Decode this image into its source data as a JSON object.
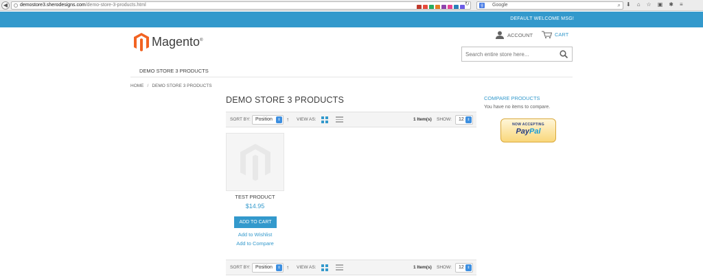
{
  "browser": {
    "url_domain": "demostore3.sherodesigns.com",
    "url_path": "/demo-store-3-products.html",
    "search_engine": "Google",
    "search_engine_icon": "g-icon"
  },
  "header": {
    "welcome_msg": "DEFAULT WELCOME MSG!",
    "logo_text": "Magento",
    "logo_mark": "®",
    "account_label": "ACCOUNT",
    "cart_label": "CART",
    "search_placeholder": "Search entire store here..."
  },
  "nav": {
    "items": [
      "DEMO STORE 3 PRODUCTS"
    ]
  },
  "breadcrumb": {
    "home": "HOME",
    "separator": "/",
    "current": "DEMO STORE 3 PRODUCTS"
  },
  "page": {
    "title": "DEMO STORE 3 PRODUCTS"
  },
  "toolbar": {
    "sort_by_label": "SORT BY:",
    "sort_value": "Position",
    "view_as_label": "VIEW AS:",
    "count_text": "1 Item(s)",
    "show_label": "SHOW:",
    "show_value": "12"
  },
  "products": [
    {
      "name": "TEST PRODUCT",
      "price": "$14.95",
      "add_to_cart": "ADD TO CART",
      "wishlist": "Add to Wishlist",
      "compare": "Add to Compare"
    }
  ],
  "sidebar": {
    "compare_title": "COMPARE PRODUCTS",
    "compare_empty": "You have no items to compare.",
    "paypal_tagline": "NOW ACCEPTING",
    "paypal_pay": "Pay",
    "paypal_pal": "Pal"
  },
  "colors": {
    "accent": "#3399cc",
    "logo_orange": "#f26322"
  }
}
